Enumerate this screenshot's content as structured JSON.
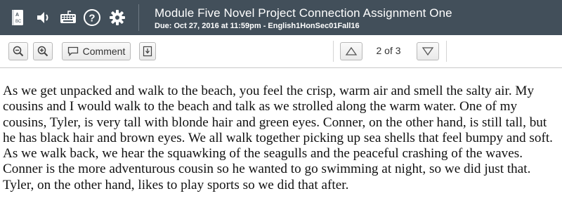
{
  "header": {
    "title": "Module Five Novel Project Connection Assignment One",
    "due": "Due: Oct 27, 2016 at 11:59pm - English1HonSec01Fall16",
    "icons": [
      "dictionary-icon",
      "speaker-icon",
      "keyboard-icon",
      "help-icon",
      "gear-icon"
    ]
  },
  "toolbar": {
    "comment_label": "Comment",
    "page_indicator": "2 of 3"
  },
  "document": {
    "text": "As we get unpacked and walk to the beach, you feel the crisp, warm air and smell the salty air. My cousins and I would walk to the beach and talk as we strolled along the warm water. One of my cousins, Tyler, is very tall with blonde hair and green eyes. Conner, on the other hand, is still tall, but he has black hair and brown eyes. We all walk together picking up sea shells that feel bumpy and soft. As we walk back, we hear the squawking of the seagulls and the peaceful crashing of the waves. Conner is the more adventurous cousin so he wanted to go swimming at night, so we did just that. Tyler, on the other hand, likes to play sports so we did that after."
  },
  "colors": {
    "header_bg": "#424f5a",
    "header_text": "#ffffff"
  }
}
